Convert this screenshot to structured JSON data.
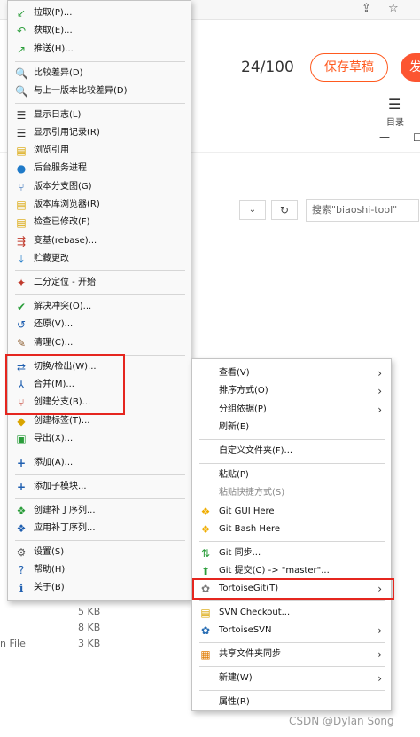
{
  "browser": {
    "word_count": "24/100",
    "save_draft": "保存草稿",
    "publish": "发",
    "toc_label": "目录",
    "share_icon": "share-icon",
    "star_icon": "star-icon"
  },
  "explorer": {
    "search_placeholder": "搜索\"biaoshi-tool\"",
    "file_sizes": [
      "5 KB",
      "8 KB",
      "3 KB"
    ],
    "file_type": "n File"
  },
  "git_menu": {
    "items": [
      {
        "label": "拉取(P)...",
        "icon": "pull-icon"
      },
      {
        "label": "获取(E)...",
        "icon": "fetch-icon"
      },
      {
        "label": "推送(H)...",
        "icon": "push-icon"
      },
      {
        "label": "比较差异(D)",
        "icon": "diff-icon"
      },
      {
        "label": "与上一版本比较差异(D)",
        "icon": "diff-previous-icon"
      },
      {
        "label": "显示日志(L)",
        "icon": "log-icon"
      },
      {
        "label": "显示引用记录(R)",
        "icon": "reflog-icon"
      },
      {
        "label": "浏览引用",
        "icon": "browse-refs-icon"
      },
      {
        "label": "后台服务进程",
        "icon": "daemon-icon"
      },
      {
        "label": "版本分支图(G)",
        "icon": "revision-graph-icon"
      },
      {
        "label": "版本库浏览器(R)",
        "icon": "repo-browser-icon"
      },
      {
        "label": "检查已修改(F)",
        "icon": "check-modifications-icon"
      },
      {
        "label": "变基(rebase)...",
        "icon": "rebase-icon"
      },
      {
        "label": "贮藏更改",
        "icon": "stash-icon"
      },
      {
        "label": "二分定位 - 开始",
        "icon": "bisect-icon"
      },
      {
        "label": "解决冲突(O)...",
        "icon": "resolve-icon"
      },
      {
        "label": "还原(V)...",
        "icon": "revert-icon"
      },
      {
        "label": "清理(C)...",
        "icon": "cleanup-icon"
      },
      {
        "label": "切换/检出(W)...",
        "icon": "switch-checkout-icon"
      },
      {
        "label": "合并(M)...",
        "icon": "merge-icon"
      },
      {
        "label": "创建分支(B)...",
        "icon": "create-branch-icon"
      },
      {
        "label": "创建标签(T)...",
        "icon": "create-tag-icon"
      },
      {
        "label": "导出(X)...",
        "icon": "export-icon"
      },
      {
        "label": "添加(A)...",
        "icon": "add-icon"
      },
      {
        "label": "添加子模块...",
        "icon": "add-submodule-icon"
      },
      {
        "label": "创建补丁序列...",
        "icon": "create-patch-icon"
      },
      {
        "label": "应用补丁序列...",
        "icon": "apply-patch-icon"
      },
      {
        "label": "设置(S)",
        "icon": "settings-icon"
      },
      {
        "label": "帮助(H)",
        "icon": "help-icon"
      },
      {
        "label": "关于(B)",
        "icon": "about-icon"
      }
    ]
  },
  "ctx_menu": {
    "items": [
      {
        "label": "查看(V)",
        "submenu": true
      },
      {
        "label": "排序方式(O)",
        "submenu": true
      },
      {
        "label": "分组依据(P)",
        "submenu": true
      },
      {
        "label": "刷新(E)"
      },
      {
        "label": "自定义文件夹(F)..."
      },
      {
        "label": "粘贴(P)"
      },
      {
        "label": "粘贴快捷方式(S)"
      },
      {
        "label": "Git GUI Here",
        "icon": "git-gui-icon"
      },
      {
        "label": "Git Bash Here",
        "icon": "git-bash-icon"
      },
      {
        "label": "Git 同步...",
        "icon": "git-sync-icon"
      },
      {
        "label": "Git 提交(C) -> \"master\"...",
        "icon": "git-commit-icon"
      },
      {
        "label": "TortoiseGit(T)",
        "icon": "tortoisegit-icon",
        "submenu": true
      },
      {
        "label": "SVN Checkout...",
        "icon": "svn-checkout-icon"
      },
      {
        "label": "TortoiseSVN",
        "icon": "tortoisesvn-icon",
        "submenu": true
      },
      {
        "label": "共享文件夹同步",
        "icon": "shared-folder-sync-icon",
        "submenu": true
      },
      {
        "label": "新建(W)",
        "submenu": true
      },
      {
        "label": "属性(R)"
      }
    ]
  },
  "watermark": "CSDN @Dylan  Song",
  "colors": {
    "highlight": "#e5261f",
    "accent": "#fc5531"
  }
}
